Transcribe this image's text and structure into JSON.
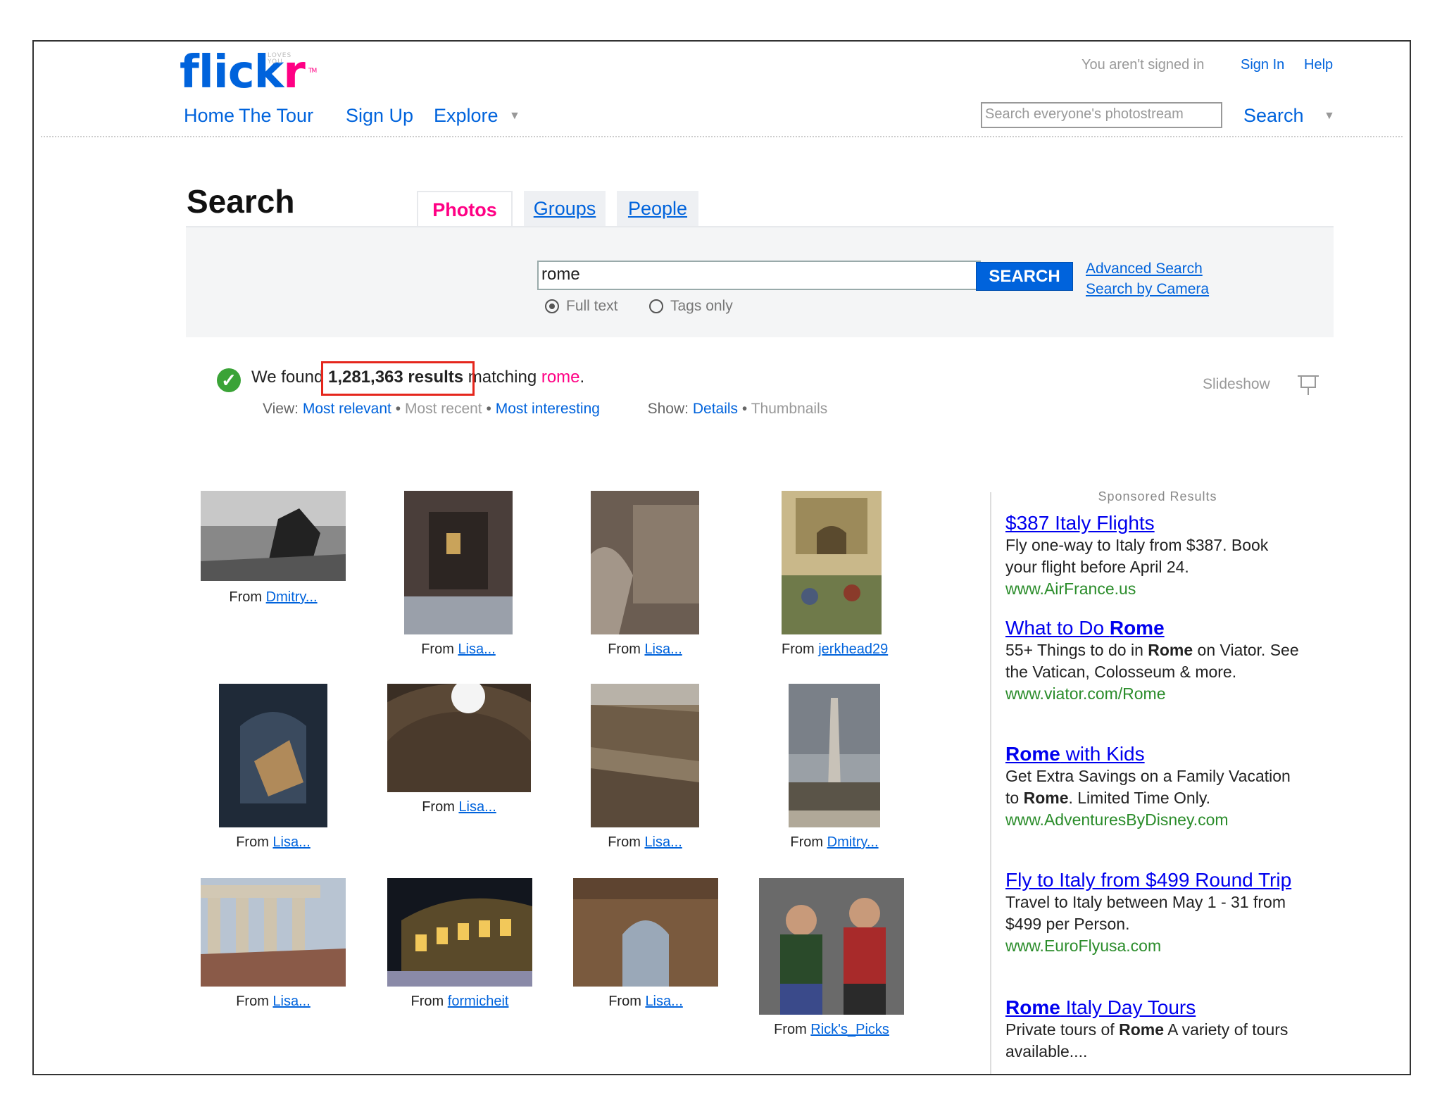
{
  "header": {
    "logo_text": "flickr",
    "logo_tagline": "LOVES YOU",
    "logo_tm": "TM",
    "nav": [
      "Home",
      "The Tour",
      "Sign Up",
      "Explore"
    ],
    "signed_in_text": "You aren't signed in",
    "sign_in": "Sign In",
    "help": "Help",
    "search_placeholder": "Search everyone's photostream",
    "search_label": "Search"
  },
  "page": {
    "title": "Search",
    "tabs": [
      "Photos",
      "Groups",
      "People"
    ],
    "query": "rome",
    "search_button": "SEARCH",
    "advanced_search": "Advanced Search",
    "search_by_camera": "Search by Camera",
    "radio_full": "Full text",
    "radio_tags": "Tags only"
  },
  "results": {
    "prefix": "We found",
    "count": "1,281,363 results",
    "matching": "matching",
    "term": "rome",
    "view_label": "View:",
    "view_options": [
      "Most relevant",
      "Most recent",
      "Most interesting"
    ],
    "show_label": "Show:",
    "show_options": [
      "Details",
      "Thumbnails"
    ],
    "slideshow": "Slideshow"
  },
  "photos": [
    {
      "from": "From",
      "user": "Dmitry..."
    },
    {
      "from": "From",
      "user": "Lisa..."
    },
    {
      "from": "From",
      "user": "Lisa..."
    },
    {
      "from": "From",
      "user": "jerkhead29"
    },
    {
      "from": "From",
      "user": "Lisa..."
    },
    {
      "from": "From",
      "user": "Lisa..."
    },
    {
      "from": "From",
      "user": "Lisa..."
    },
    {
      "from": "From",
      "user": "Dmitry..."
    },
    {
      "from": "From",
      "user": "Lisa..."
    },
    {
      "from": "From",
      "user": "formicheit"
    },
    {
      "from": "From",
      "user": "Lisa..."
    },
    {
      "from": "From",
      "user": "Rick's_Picks"
    }
  ],
  "sponsored": {
    "heading": "Sponsored Results",
    "ads": [
      {
        "title": "$387 Italy Flights",
        "body": "Fly one-way to Italy from $387. Book your flight before April 24.",
        "url": "www.AirFrance.us"
      },
      {
        "title_pre": "What to Do ",
        "title_bold": "Rome",
        "body_1": "55+ Things to do in ",
        "body_bold": "Rome",
        "body_2": " on Viator. See the Vatican, Colosseum & more.",
        "url": "www.viator.com/Rome"
      },
      {
        "title_bold": "Rome",
        "title_post": " with Kids",
        "body_1": "Get Extra Savings on a Family Vacation to ",
        "body_bold": "Rome",
        "body_2": ". Limited Time Only.",
        "url": "www.AdventuresByDisney.com"
      },
      {
        "title": "Fly to Italy from $499 Round Trip",
        "body": "Travel to Italy between May 1 - 31 from $499 per Person.",
        "url": "www.EuroFlyusa.com"
      },
      {
        "title_bold": "Rome",
        "title_post": " Italy Day Tours",
        "body_1": "Private tours of ",
        "body_bold": "Rome",
        "body_2": " A variety of tours available...."
      }
    ]
  }
}
